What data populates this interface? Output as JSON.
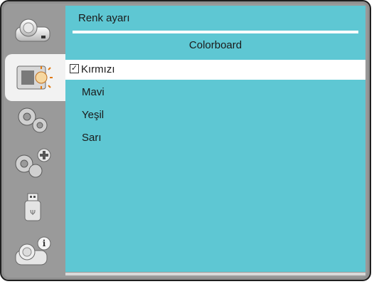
{
  "header": {
    "breadcrumb": "Renk ayarı"
  },
  "section": {
    "title": "Colorboard"
  },
  "menu": {
    "items": [
      {
        "label": "Kırmızı",
        "checked": true,
        "selected": true
      },
      {
        "label": "Mavi"
      },
      {
        "label": "Yeşil"
      },
      {
        "label": "Sarı"
      }
    ],
    "check_glyph": "✓"
  },
  "sidebar": {
    "items": [
      {
        "icon": "projector-icon"
      },
      {
        "icon": "display-settings-icon",
        "active": true
      },
      {
        "icon": "gear-icon"
      },
      {
        "icon": "gear-plus-icon"
      },
      {
        "icon": "usb-icon"
      },
      {
        "icon": "projector-info-icon"
      }
    ]
  },
  "colors": {
    "content_bg": "#5ec7d3",
    "frame": "#9a9a9a",
    "selected_row": "#ffffff"
  }
}
